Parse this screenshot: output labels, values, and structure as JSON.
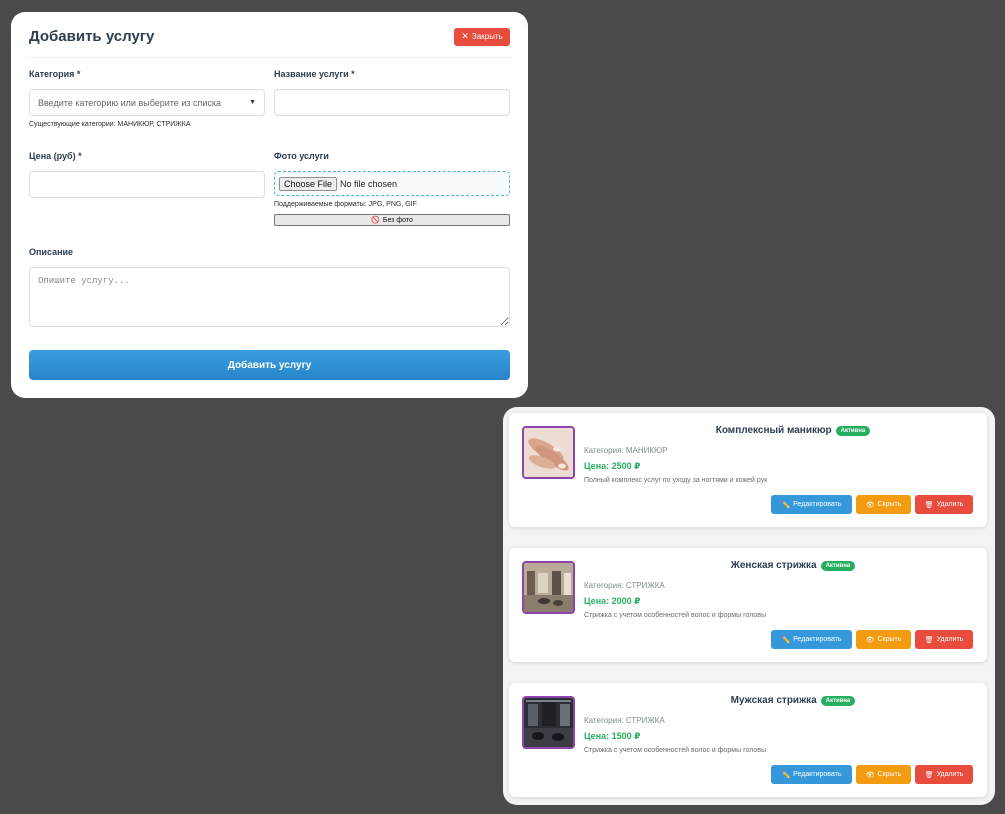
{
  "form": {
    "title": "Добавить услугу",
    "close_label": "Закрыть",
    "category": {
      "label": "Категория *",
      "placeholder": "Введите категорию или выберите из списка",
      "hint": "Существующие категории: МАНИКЮР, СТРИЖКА"
    },
    "service_name": {
      "label": "Название услуги *",
      "value": ""
    },
    "price": {
      "label": "Цена (руб) *",
      "value": ""
    },
    "photo": {
      "label": "Фото услуги",
      "choose_label": "Choose File",
      "file_status": "No file chosen",
      "hint": "Поддерживаемые форматы: JPG, PNG, GIF",
      "no_photo_label": "Без фото"
    },
    "description": {
      "label": "Описание",
      "placeholder": "Опишите услугу..."
    },
    "submit_label": "Добавить услугу"
  },
  "services": [
    {
      "name": "Комплексный маникюр",
      "status": "Активна",
      "category": "Категория: МАНИКЮР",
      "price": "Цена: 2500 ₽",
      "description": "Полный комплекс услуг по уходу за ногтями и кожей рук",
      "image": "manicure-hands-photo"
    },
    {
      "name": "Женская стрижка",
      "status": "Активна",
      "category": "Категория: СТРИЖКА",
      "price": "Цена: 2000 ₽",
      "description": "Стрижка с учетом особенностей волос и формы головы",
      "image": "salon-interior-photo"
    },
    {
      "name": "Мужская стрижка",
      "status": "Активна",
      "category": "Категория: СТРИЖКА",
      "price": "Цена: 1500 ₽",
      "description": "Стрижка с учетом особенностей волос и формы головы",
      "image": "barbershop-interior-photo"
    }
  ],
  "card_actions": {
    "edit": "Редактировать",
    "hide": "Скрыть",
    "delete": "Удалить"
  },
  "colors": {
    "accent": "#3498db",
    "danger": "#e74c3c",
    "warning": "#f39c12",
    "success": "#27ae60",
    "thumb_border": "#8e44ad",
    "backdrop": "#4a4a4a"
  }
}
